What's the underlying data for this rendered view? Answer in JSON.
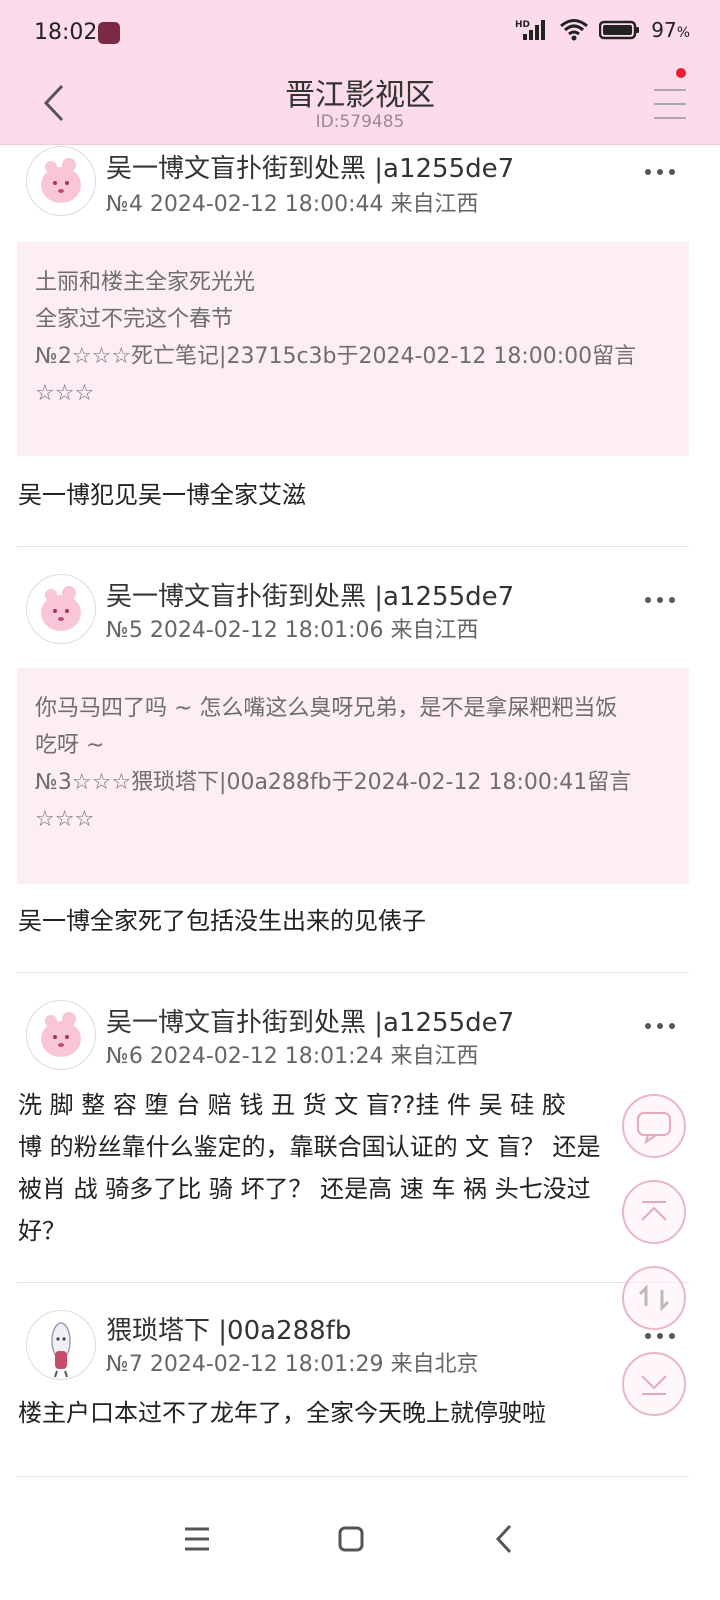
{
  "status_bar": {
    "time": "18:02",
    "battery_pct": "97",
    "battery_unit": "%",
    "signal_label": "HD"
  },
  "header": {
    "title": "晋江影视区",
    "subtitle": "ID:579485"
  },
  "posts": [
    {
      "author": "吴一博文盲扑街到处黑 |a1255de7",
      "meta": "№4 2024-02-12 18:00:44 来自江西",
      "quote": {
        "lines": [
          "土丽和楼主全家死光光",
          "全家过不完这个春节",
          "№2☆☆☆死亡笔记|23715c3b于2024-02-12 18:00:00留言",
          "☆☆☆"
        ]
      },
      "body_lines": [
        "吴一博犯见吴一博全家艾滋"
      ]
    },
    {
      "author": "吴一博文盲扑街到处黑 |a1255de7",
      "meta": "№5 2024-02-12 18:01:06 来自江西",
      "quote": {
        "lines": [
          "你马马四了吗 ~ 怎么嘴这么臭呀兄弟，是不是拿屎粑粑当饭",
          "吃呀 ~",
          "№3☆☆☆猥琐塔下|00a288fb于2024-02-12 18:00:41留言",
          "☆☆☆"
        ]
      },
      "body_lines": [
        "吴一博全家死了包括没生出来的见俵子"
      ]
    },
    {
      "author": "吴一博文盲扑街到处黑 |a1255de7",
      "meta": "№6 2024-02-12 18:01:24 来自江西",
      "body_lines": [
        "洗 脚 整 容 堕 台 赔 钱 丑 货 文 盲??挂 件 吴 硅 胶",
        "博 的粉丝靠什么鉴定的，靠联合国认证的  文 盲？ 还是",
        "被肖 战 骑多了比 骑 坏了？ 还是高 速 车 祸 头七没过",
        "好？"
      ]
    },
    {
      "author": "猥琐塔下 |00a288fb",
      "meta": "№7 2024-02-12 18:01:29 来自北京",
      "body_lines": [
        "楼主户口本过不了龙年了，全家今天晚上就停驶啦"
      ]
    }
  ],
  "floating_buttons": [
    {
      "name": "reply-fab",
      "icon": "chat-bubble-icon"
    },
    {
      "name": "scroll-top-fab",
      "icon": "arrow-to-top-icon"
    },
    {
      "name": "refresh-fab",
      "icon": "refresh-icon"
    },
    {
      "name": "scroll-bottom-fab",
      "icon": "arrow-to-bottom-icon"
    }
  ],
  "colors": {
    "header_bg": "#fcdcea",
    "quote_bg": "#fdeef5",
    "fab_border": "#eab5cb",
    "notification_dot": "#ee1c32"
  }
}
